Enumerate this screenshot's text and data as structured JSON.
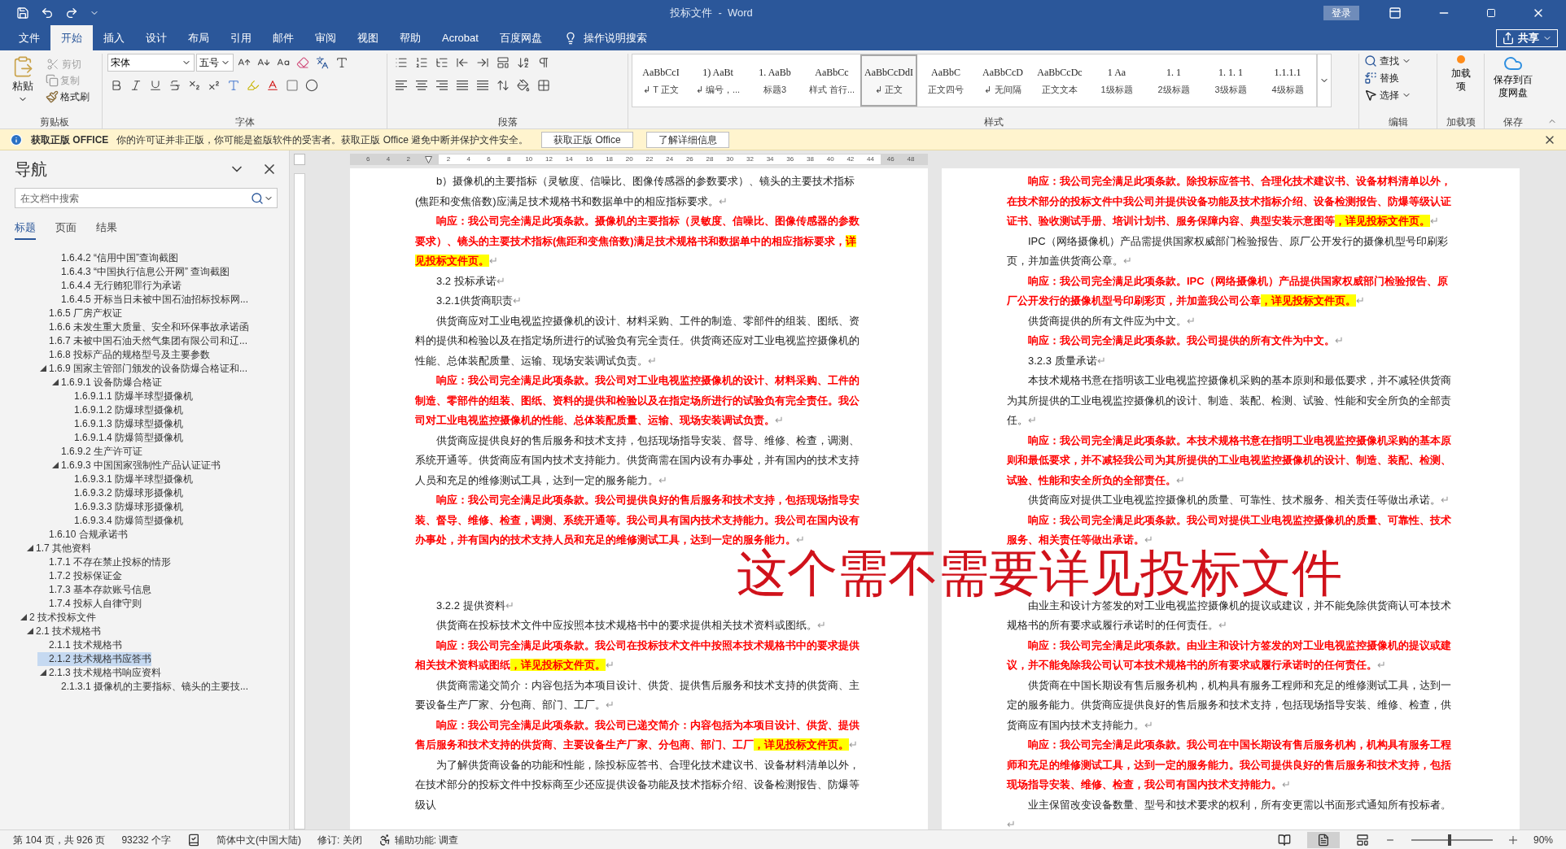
{
  "title_bar": {
    "title": "投标文件  -  Word",
    "login": "登录"
  },
  "menu_tabs": [
    {
      "label": "文件",
      "selected": false
    },
    {
      "label": "开始",
      "selected": true
    },
    {
      "label": "插入",
      "selected": false
    },
    {
      "label": "设计",
      "selected": false
    },
    {
      "label": "布局",
      "selected": false
    },
    {
      "label": "引用",
      "selected": false
    },
    {
      "label": "邮件",
      "selected": false
    },
    {
      "label": "审阅",
      "selected": false
    },
    {
      "label": "视图",
      "selected": false
    },
    {
      "label": "帮助",
      "selected": false
    },
    {
      "label": "Acrobat",
      "selected": false
    },
    {
      "label": "百度网盘",
      "selected": false
    }
  ],
  "tell_me": "操作说明搜索",
  "share": "共享",
  "ribbon": {
    "clipboard": {
      "label": "剪贴板",
      "paste": "粘贴",
      "cut": "剪切",
      "copy": "复制",
      "cut_disabled": true,
      "format_painter": "格式刷"
    },
    "font": {
      "label": "字体",
      "font_name": "宋体",
      "font_size": "五号"
    },
    "paragraph": {
      "label": "段落"
    },
    "styles": {
      "label": "样式",
      "items": [
        {
          "preview": "AaBbCcI",
          "name": "↲ T 正文",
          "selected": false
        },
        {
          "preview": "1)  AaBt",
          "name": "↲ 编号，...",
          "selected": false
        },
        {
          "preview": "1.  AaBb",
          "name": "标题3",
          "selected": false
        },
        {
          "preview": "AaBbCc",
          "name": "样式 首行...",
          "selected": false
        },
        {
          "preview": "AaBbCcDdI",
          "name": "↲ 正文",
          "selected": true
        },
        {
          "preview": "AaBbC",
          "name": "正文四号",
          "selected": false
        },
        {
          "preview": "AaBbCcD",
          "name": "↲ 无间隔",
          "selected": false
        },
        {
          "preview": "AaBbCcDc",
          "name": "正文文本",
          "selected": false
        },
        {
          "preview": "1    Aa",
          "name": "1级标题",
          "selected": false
        },
        {
          "preview": "1. 1",
          "name": "2级标题",
          "selected": false
        },
        {
          "preview": "1. 1. 1",
          "name": "3级标题",
          "selected": false
        },
        {
          "preview": "1.1.1.1",
          "name": "4级标题",
          "selected": false
        }
      ]
    },
    "editing": {
      "label": "编辑",
      "find": "查找",
      "replace": "替换",
      "select": "选择"
    },
    "addins": {
      "label": "加载项",
      "button": "加载项"
    },
    "save": {
      "label": "保存",
      "button": "保存到百度网盘"
    }
  },
  "warning_bar": {
    "title": "获取正版 OFFICE",
    "message": "你的许可证并非正版，你可能是盗版软件的受害者。获取正版 Office 避免中断并保护文件安全。",
    "buttons": [
      "获取正版 Office",
      "了解详细信息"
    ]
  },
  "navigation": {
    "title": "导航",
    "search": {
      "placeholder": "在文档中搜索"
    },
    "tabs": [
      {
        "label": "标题",
        "selected": true
      },
      {
        "label": "页面",
        "selected": false
      },
      {
        "label": "结果",
        "selected": false
      }
    ],
    "tree": [
      {
        "children": [
          {
            "children": [
              {
                "children": [
                  {
                    "label": "1.6.4.2 “信用中国”查询截图",
                    "selected": false
                  },
                  {
                    "label": "1.6.4.3 “中国执行信息公开网” 查询截图",
                    "selected": false
                  },
                  {
                    "label": "1.6.4.4 无行贿犯罪行为承诺",
                    "selected": false
                  },
                  {
                    "label": "1.6.4.5 开标当日未被中国石油招标投标网...",
                    "selected": false
                  }
                ]
              },
              {
                "label": "1.6.5 厂房产权证",
                "selected": false
              },
              {
                "label": "1.6.6 未发生重大质量、安全和环保事故承诺函",
                "selected": false
              },
              {
                "label": "1.6.7 未被中国石油天然气集团有限公司和辽...",
                "selected": false
              },
              {
                "label": "1.6.8 投标产品的规格型号及主要参数",
                "selected": false
              },
              {
                "label": "1.6.9 国家主管部门颁发的设备防爆合格证和...",
                "selected": false,
                "expanded": true,
                "children": [
                  {
                    "label": "1.6.9.1 设备防爆合格证",
                    "selected": false,
                    "expanded": true,
                    "children": [
                      {
                        "label": "1.6.9.1.1 防爆半球型摄像机",
                        "selected": false
                      },
                      {
                        "label": "1.6.9.1.2 防爆球型摄像机",
                        "selected": false
                      },
                      {
                        "label": "1.6.9.1.3 防爆球型摄像机",
                        "selected": false
                      },
                      {
                        "label": "1.6.9.1.4 防爆筒型摄像机",
                        "selected": false
                      }
                    ]
                  },
                  {
                    "label": "1.6.9.2 生产许可证",
                    "selected": false
                  },
                  {
                    "label": "1.6.9.3 中国国家强制性产品认证证书",
                    "selected": false,
                    "expanded": true,
                    "children": [
                      {
                        "label": "1.6.9.3.1 防爆半球型摄像机",
                        "selected": false
                      },
                      {
                        "label": "1.6.9.3.2 防爆球形摄像机",
                        "selected": false
                      },
                      {
                        "label": "1.6.9.3.3 防爆球形摄像机",
                        "selected": false
                      },
                      {
                        "label": "1.6.9.3.4 防爆筒型摄像机",
                        "selected": false
                      }
                    ]
                  }
                ]
              },
              {
                "label": "1.6.10 合规承诺书",
                "selected": false
              }
            ]
          },
          {
            "label": "1.7 其他资料",
            "selected": false,
            "expanded": true,
            "children": [
              {
                "label": "1.7.1 不存在禁止投标的情形",
                "selected": false
              },
              {
                "label": "1.7.2 投标保证金",
                "selected": false
              },
              {
                "label": "1.7.3 基本存款账号信息",
                "selected": false
              },
              {
                "label": "1.7.4 投标人自律守则",
                "selected": false
              }
            ]
          }
        ]
      },
      {
        "label": "2 技术投标文件",
        "selected": false,
        "expanded": true,
        "children": [
          {
            "label": "2.1 技术规格书",
            "selected": false,
            "expanded": true,
            "children": [
              {
                "label": "2.1.1 技术规格书",
                "selected": false
              },
              {
                "label": "2.1.2 技术规格书应答书",
                "selected": true
              },
              {
                "label": "2.1.3 技术规格书响应资料",
                "selected": false,
                "expanded": true,
                "children": [
                  {
                    "label": "2.1.3.1 摄像机的主要指标、镜头的主要技...",
                    "selected": false
                  }
                ]
              }
            ]
          }
        ]
      }
    ]
  },
  "ruler": {
    "left_labels": [
      "6",
      "4",
      "2"
    ],
    "right_labels": [
      "2",
      "4",
      "6",
      "8",
      "10",
      "12",
      "14",
      "16",
      "18",
      "20",
      "22",
      "24",
      "26",
      "28",
      "30",
      "32",
      "34",
      "36",
      "38",
      "40",
      "42",
      "44",
      "46",
      "48"
    ]
  },
  "pages": [
    {
      "paragraphs": [
        {
          "kind": "body",
          "text": "b）摄像机的主要指标（灵敏度、信噪比、图像传感器的参数要求）、镜头的主要技术指标(焦距和变焦倍数)应满足技术规格书和数据单中的相应指标要求。",
          "end_mark": "↵"
        },
        {
          "kind": "response",
          "text": "响应：我公司完全满足此项条款。摄像机的主要指标（灵敏度、信噪比、图像传感器的参数要求）、镜头的主要技术指标(焦距和变焦倍数)满足技术规格书和数据单中的相应指标要求，",
          "highlight": "详见投标文件页。",
          "end_mark": "↵"
        },
        {
          "kind": "heading",
          "text": "3.2  投标承诺",
          "end_mark": "↵"
        },
        {
          "kind": "heading",
          "text": "3.2.1供货商职责",
          "end_mark": "↵"
        },
        {
          "kind": "body",
          "text": "供货商应对工业电视监控摄像机的设计、材料采购、工件的制造、零部件的组装、图纸、资料的提供和检验以及在指定场所进行的试验负有完全责任。供货商还应对工业电视监控摄像机的性能、总体装配质量、运输、现场安装调试负责。",
          "end_mark": "↵"
        },
        {
          "kind": "response",
          "text": "响应：我公司完全满足此项条款。我公司对工业电视监控摄像机的设计、材料采购、工件的制造、零部件的组装、图纸、资料的提供和检验以及在指定场所进行的试验负有完全责任。我公司对工业电视监控摄像机的性能、总体装配质量、运输、现场安装调试负责。",
          "end_mark": "↵"
        },
        {
          "kind": "body",
          "text": "供货商应提供良好的售后服务和技术支持，包括现场指导安装、督导、维修、检查，调测、系统开通等。供货商应有国内技术支持能力。供货商需在国内设有办事处，并有国内的技术支持人员和充足的维修测试工具，达到一定的服务能力。",
          "end_mark": "↵"
        },
        {
          "kind": "response",
          "text": "响应：我公司完全满足此项条款。我公司提供良好的售后服务和技术支持，包括现场指导安装、督导、维修、检查，调测、系统开通等。我公司具有国内技术支持能力。我公司在国内设有办事处，并有国内的技术支持人员和充足的维修测试工具，达到一定的服务能力。",
          "end_mark": "↵"
        }
      ],
      "paragraphs_below_note": [
        {
          "kind": "heading",
          "text": "3.2.2  提供资料",
          "end_mark": "↵"
        },
        {
          "kind": "body",
          "text": "供货商在投标技术文件中应按照本技术规格书中的要求提供相关技术资料或图纸。",
          "end_mark": "↵"
        },
        {
          "kind": "response",
          "text": "响应：我公司完全满足此项条款。我公司在投标技术文件中按照本技术规格书中的要求提供相关技术资料或图纸",
          "highlight": "，详见投标文件页。",
          "end_mark": "↵"
        },
        {
          "kind": "body",
          "text": "供货商需递交简介：内容包括为本项目设计、供货、提供售后服务和技术支持的供货商、主要设备生产厂家、分包商、部门、工厂。",
          "end_mark": "↵"
        },
        {
          "kind": "response",
          "text": "响应：我公司完全满足此项条款。我公司已递交简介：内容包括为本项目设计、供货、提供售后服务和技术支持的供货商、主要设备生产厂家、分包商、部门、工厂",
          "highlight": "，详见投标文件页。",
          "end_mark": "↵"
        },
        {
          "kind": "body",
          "text": "为了解供货商设备的功能和性能，除投标应答书、合理化技术建议书、设备材料清单以外，在技术部分的投标文件中投标商至少还应提供设备功能及技术指标介绍、设备检测报告、防爆等级认"
        }
      ]
    },
    {
      "paragraphs": [
        {
          "kind": "response",
          "text": "响应：我公司完全满足此项条款。除投标应答书、合理化技术建议书、设备材料清单以外，在技术部分的投标文件中我公司并提供设备功能及技术指标介绍、设备检测报告、防爆等级认证证书、验收测试手册、培训计划书、服务保障内容、典型安装示意图等",
          "highlight": "，详见投标文件页。",
          "end_mark": "↵"
        },
        {
          "kind": "body",
          "text": "IPC（网络摄像机）产品需提供国家权威部门检验报告、原厂公开发行的摄像机型号印刷彩页，并加盖供货商公章。",
          "end_mark": "↵"
        },
        {
          "kind": "response",
          "text": "响应：我公司完全满足此项条款。IPC（网络摄像机）产品提供国家权威部门检验报告、原厂公开发行的摄像机型号印刷彩页，并加盖我公司公章",
          "highlight": "，详见投标文件页。",
          "end_mark": "↵"
        },
        {
          "kind": "body",
          "text": "供货商提供的所有文件应为中文。",
          "end_mark": "↵"
        },
        {
          "kind": "response",
          "text": "响应：我公司完全满足此项条款。我公司提供的所有文件为中文。",
          "end_mark": "↵"
        },
        {
          "kind": "heading",
          "text": "3.2.3  质量承诺",
          "end_mark": "↵"
        },
        {
          "kind": "body",
          "text": "本技术规格书意在指明该工业电视监控摄像机采购的基本原则和最低要求，并不减轻供货商为其所提供的工业电视监控摄像机的设计、制造、装配、检测、试验、性能和安全所负的全部责任。",
          "end_mark": "↵"
        },
        {
          "kind": "response",
          "text": "响应：我公司完全满足此项条款。本技术规格书意在指明工业电视监控摄像机采购的基本原则和最低要求，并不减轻我公司为其所提供的工业电视监控摄像机的设计、制造、装配、检测、试验、性能和安全所负的全部责任。",
          "end_mark": "↵"
        },
        {
          "kind": "body",
          "text": "供货商应对提供工业电视监控摄像机的质量、可靠性、技术服务、相关责任等做出承诺。",
          "end_mark": "↵"
        },
        {
          "kind": "response",
          "text": "响应：我公司完全满足此项条款。我公司对提供工业电视监控摄像机的质量、可靠性、技术服务、相关责任等做出承诺。",
          "end_mark": "↵"
        }
      ],
      "paragraphs_below_note": [
        {
          "kind": "body",
          "text": "由业主和设计方签发的对工业电视监控摄像机的提议或建议，并不能免除供货商认可本技术规格书的所有要求或履行承诺时的任何责任。",
          "end_mark": "↵"
        },
        {
          "kind": "response",
          "text": "响应：我公司完全满足此项条款。由业主和设计方签发的对工业电视监控摄像机的提议或建议，并不能免除我公司认可本技术规格书的所有要求或履行承诺时的任何责任。",
          "end_mark": "↵"
        },
        {
          "kind": "body",
          "text": "供货商在中国长期设有售后服务机构，机构具有服务工程师和充足的维修测试工具，达到一定的服务能力。供货商应提供良好的售后服务和技术支持，包括现场指导安装、维修、检查，供货商应有国内技术支持能力。",
          "end_mark": "↵"
        },
        {
          "kind": "response",
          "text": "响应：我公司完全满足此项条款。我公司在中国长期设有售后服务机构，机构具有服务工程师和充足的维修测试工具，达到一定的服务能力。我公司提供良好的售后服务和技术支持，包括现场指导安装、维修、检查，我公司有国内技术支持能力。",
          "end_mark": "↵"
        },
        {
          "kind": "body",
          "text": "业主保留改变设备数量、型号和技术要求的权利，所有变更需以书面形式通知所有投标者。",
          "end_mark": "↵"
        }
      ]
    }
  ],
  "annotation": {
    "text": "这个需不需要详见投标文件"
  },
  "status_bar": {
    "page": "第 104 页，共 926 页",
    "words": "93232 个字",
    "language": "简体中文(中国大陆)",
    "track_changes": "修订: 关闭",
    "accessibility": "辅助功能: 调查",
    "zoom": {
      "level": 0.47,
      "reading": "90%"
    }
  }
}
